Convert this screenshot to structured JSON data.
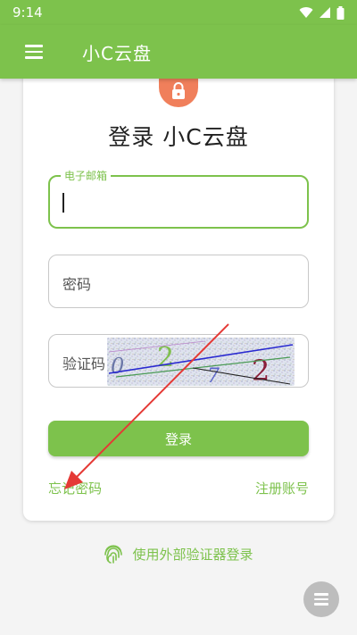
{
  "status_bar": {
    "time": "9:14"
  },
  "app_bar": {
    "title": "小C云盘"
  },
  "login": {
    "title": "登录 小C云盘",
    "email_label": "电子邮箱",
    "password_placeholder": "密码",
    "captcha_placeholder": "验证码",
    "submit_label": "登录",
    "forgot_link": "忘记密码",
    "register_link": "注册账号",
    "external_login": "使用外部验证器登录"
  },
  "colors": {
    "accent": "#7dc24c",
    "lock_badge": "#f07f5b",
    "annotation_arrow": "#e53935"
  },
  "icons": [
    "menu-icon",
    "wifi-icon",
    "signal-icon",
    "battery-icon",
    "lock-icon",
    "fingerprint-icon",
    "floating-menu-icon"
  ]
}
